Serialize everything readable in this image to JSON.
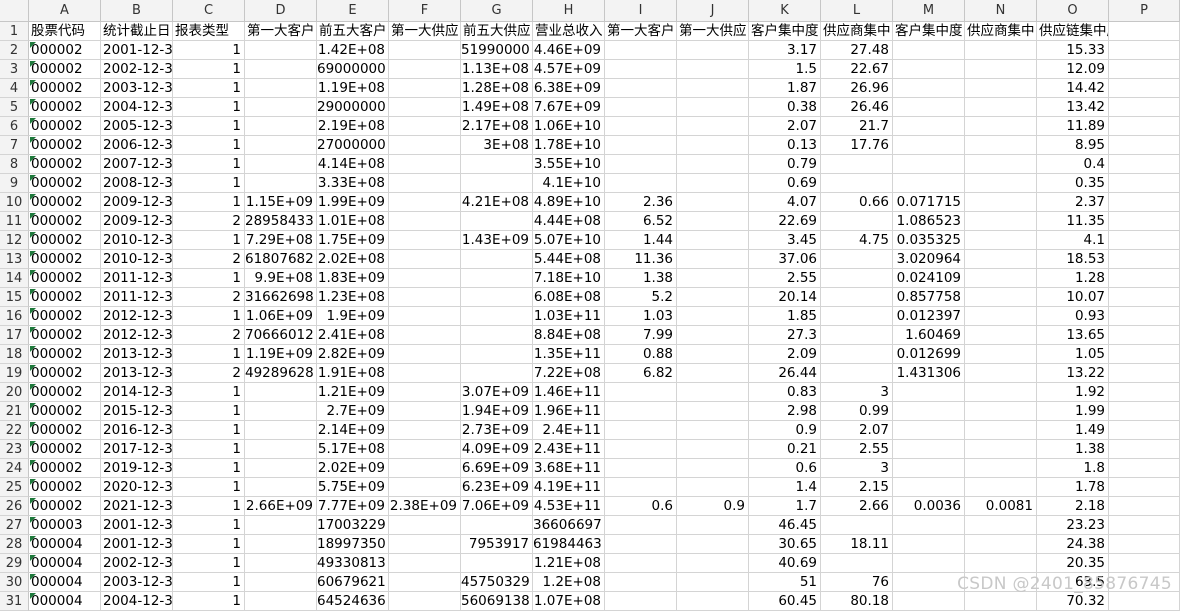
{
  "columns": [
    "A",
    "B",
    "C",
    "D",
    "E",
    "F",
    "G",
    "H",
    "I",
    "J",
    "K",
    "L",
    "M",
    "N",
    "O",
    "P"
  ],
  "header_row": [
    "股票代码",
    "统计截止日",
    "报表类型",
    "第一大客户",
    "前五大客户",
    "第一大供应",
    "前五大供应",
    "营业总收入",
    "第一大客户",
    "第一大供应",
    "客户集中度",
    "供应商集中",
    "客户集中度",
    "供应商集中",
    "供应链集中度",
    ""
  ],
  "rows": [
    [
      "000002",
      "2001-12-3",
      "1",
      "",
      "1.42E+08",
      "",
      "51990000",
      "4.46E+09",
      "",
      "",
      "3.17",
      "27.48",
      "",
      "",
      "15.33",
      ""
    ],
    [
      "000002",
      "2002-12-3",
      "1",
      "",
      "69000000",
      "",
      "1.13E+08",
      "4.57E+09",
      "",
      "",
      "1.5",
      "22.67",
      "",
      "",
      "12.09",
      ""
    ],
    [
      "000002",
      "2003-12-3",
      "1",
      "",
      "1.19E+08",
      "",
      "1.28E+08",
      "6.38E+09",
      "",
      "",
      "1.87",
      "26.96",
      "",
      "",
      "14.42",
      ""
    ],
    [
      "000002",
      "2004-12-3",
      "1",
      "",
      "29000000",
      "",
      "1.49E+08",
      "7.67E+09",
      "",
      "",
      "0.38",
      "26.46",
      "",
      "",
      "13.42",
      ""
    ],
    [
      "000002",
      "2005-12-3",
      "1",
      "",
      "2.19E+08",
      "",
      "2.17E+08",
      "1.06E+10",
      "",
      "",
      "2.07",
      "21.7",
      "",
      "",
      "11.89",
      ""
    ],
    [
      "000002",
      "2006-12-3",
      "1",
      "",
      "27000000",
      "",
      "3E+08",
      "1.78E+10",
      "",
      "",
      "0.13",
      "17.76",
      "",
      "",
      "8.95",
      ""
    ],
    [
      "000002",
      "2007-12-3",
      "1",
      "",
      "4.14E+08",
      "",
      "",
      "3.55E+10",
      "",
      "",
      "0.79",
      "",
      "",
      "",
      "0.4",
      ""
    ],
    [
      "000002",
      "2008-12-3",
      "1",
      "",
      "3.33E+08",
      "",
      "",
      "4.1E+10",
      "",
      "",
      "0.69",
      "",
      "",
      "",
      "0.35",
      ""
    ],
    [
      "000002",
      "2009-12-3",
      "1",
      "1.15E+09",
      "1.99E+09",
      "",
      "4.21E+08",
      "4.89E+10",
      "2.36",
      "",
      "4.07",
      "0.66",
      "0.071715",
      "",
      "2.37",
      ""
    ],
    [
      "000002",
      "2009-12-3",
      "2",
      "28958433",
      "1.01E+08",
      "",
      "",
      "4.44E+08",
      "6.52",
      "",
      "22.69",
      "",
      "1.086523",
      "",
      "11.35",
      ""
    ],
    [
      "000002",
      "2010-12-3",
      "1",
      "7.29E+08",
      "1.75E+09",
      "",
      "1.43E+09",
      "5.07E+10",
      "1.44",
      "",
      "3.45",
      "4.75",
      "0.035325",
      "",
      "4.1",
      ""
    ],
    [
      "000002",
      "2010-12-3",
      "2",
      "61807682",
      "2.02E+08",
      "",
      "",
      "5.44E+08",
      "11.36",
      "",
      "37.06",
      "",
      "3.020964",
      "",
      "18.53",
      ""
    ],
    [
      "000002",
      "2011-12-3",
      "1",
      "9.9E+08",
      "1.83E+09",
      "",
      "",
      "7.18E+10",
      "1.38",
      "",
      "2.55",
      "",
      "0.024109",
      "",
      "1.28",
      ""
    ],
    [
      "000002",
      "2011-12-3",
      "2",
      "31662698",
      "1.23E+08",
      "",
      "",
      "6.08E+08",
      "5.2",
      "",
      "20.14",
      "",
      "0.857758",
      "",
      "10.07",
      ""
    ],
    [
      "000002",
      "2012-12-3",
      "1",
      "1.06E+09",
      "1.9E+09",
      "",
      "",
      "1.03E+11",
      "1.03",
      "",
      "1.85",
      "",
      "0.012397",
      "",
      "0.93",
      ""
    ],
    [
      "000002",
      "2012-12-3",
      "2",
      "70666012",
      "2.41E+08",
      "",
      "",
      "8.84E+08",
      "7.99",
      "",
      "27.3",
      "",
      "1.60469",
      "",
      "13.65",
      ""
    ],
    [
      "000002",
      "2013-12-3",
      "1",
      "1.19E+09",
      "2.82E+09",
      "",
      "",
      "1.35E+11",
      "0.88",
      "",
      "2.09",
      "",
      "0.012699",
      "",
      "1.05",
      ""
    ],
    [
      "000002",
      "2013-12-3",
      "2",
      "49289628",
      "1.91E+08",
      "",
      "",
      "7.22E+08",
      "6.82",
      "",
      "26.44",
      "",
      "1.431306",
      "",
      "13.22",
      ""
    ],
    [
      "000002",
      "2014-12-3",
      "1",
      "",
      "1.21E+09",
      "",
      "3.07E+09",
      "1.46E+11",
      "",
      "",
      "0.83",
      "3",
      "",
      "",
      "1.92",
      ""
    ],
    [
      "000002",
      "2015-12-3",
      "1",
      "",
      "2.7E+09",
      "",
      "1.94E+09",
      "1.96E+11",
      "",
      "",
      "2.98",
      "0.99",
      "",
      "",
      "1.99",
      ""
    ],
    [
      "000002",
      "2016-12-3",
      "1",
      "",
      "2.14E+09",
      "",
      "2.73E+09",
      "2.4E+11",
      "",
      "",
      "0.9",
      "2.07",
      "",
      "",
      "1.49",
      ""
    ],
    [
      "000002",
      "2017-12-3",
      "1",
      "",
      "5.17E+08",
      "",
      "4.09E+09",
      "2.43E+11",
      "",
      "",
      "0.21",
      "2.55",
      "",
      "",
      "1.38",
      ""
    ],
    [
      "000002",
      "2019-12-3",
      "1",
      "",
      "2.02E+09",
      "",
      "6.69E+09",
      "3.68E+11",
      "",
      "",
      "0.6",
      "3",
      "",
      "",
      "1.8",
      ""
    ],
    [
      "000002",
      "2020-12-3",
      "1",
      "",
      "5.75E+09",
      "",
      "6.23E+09",
      "4.19E+11",
      "",
      "",
      "1.4",
      "2.15",
      "",
      "",
      "1.78",
      ""
    ],
    [
      "000002",
      "2021-12-3",
      "1",
      "2.66E+09",
      "7.77E+09",
      "2.38E+09",
      "7.06E+09",
      "4.53E+11",
      "0.6",
      "0.9",
      "1.7",
      "2.66",
      "0.0036",
      "0.0081",
      "2.18",
      ""
    ],
    [
      "000003",
      "2001-12-3",
      "1",
      "",
      "17003229",
      "",
      "",
      "36606697",
      "",
      "",
      "46.45",
      "",
      "",
      "",
      "23.23",
      ""
    ],
    [
      "000004",
      "2001-12-3",
      "1",
      "",
      "18997350",
      "",
      "7953917",
      "61984463",
      "",
      "",
      "30.65",
      "18.11",
      "",
      "",
      "24.38",
      ""
    ],
    [
      "000004",
      "2002-12-3",
      "1",
      "",
      "49330813",
      "",
      "",
      "1.21E+08",
      "",
      "",
      "40.69",
      "",
      "",
      "",
      "20.35",
      ""
    ],
    [
      "000004",
      "2003-12-3",
      "1",
      "",
      "60679621",
      "",
      "45750329",
      "1.2E+08",
      "",
      "",
      "51",
      "76",
      "",
      "",
      "63.5",
      ""
    ],
    [
      "000004",
      "2004-12-3",
      "1",
      "",
      "64524636",
      "",
      "56069138",
      "1.07E+08",
      "",
      "",
      "60.45",
      "80.18",
      "",
      "",
      "70.32",
      ""
    ]
  ],
  "watermark": "CSDN @2401_85876745"
}
